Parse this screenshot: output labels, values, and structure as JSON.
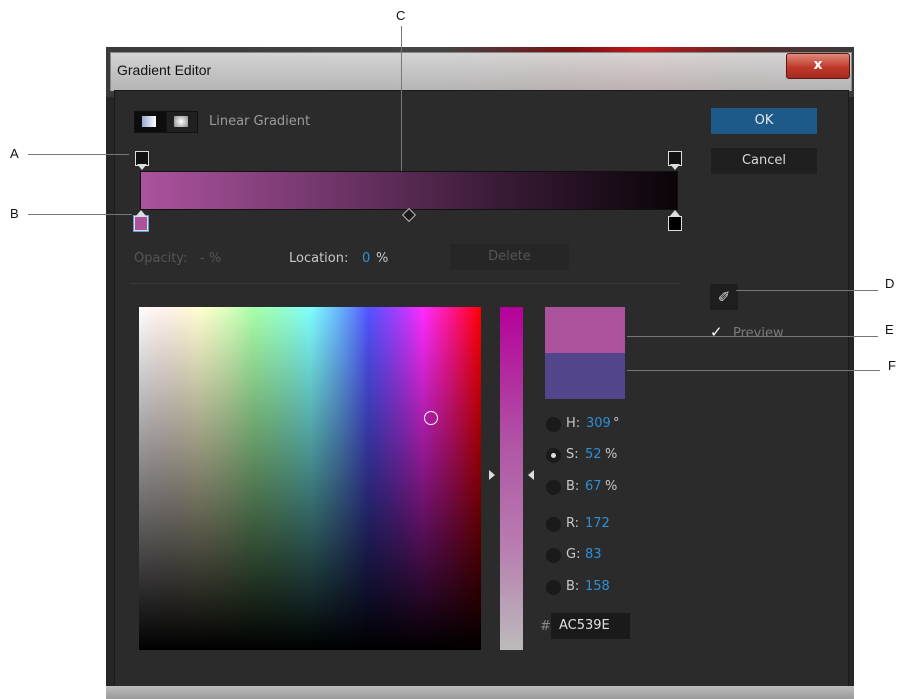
{
  "window": {
    "title": "Gradient Editor",
    "close_glyph": "x"
  },
  "gradient_type": {
    "label": "Linear Gradient",
    "options": [
      "linear-gradient-icon",
      "radial-gradient-icon"
    ]
  },
  "buttons": {
    "ok": "OK",
    "cancel": "Cancel",
    "delete": "Delete"
  },
  "stop_settings": {
    "opacity_label": "Opacity:",
    "opacity_value": "- %",
    "location_label": "Location:",
    "location_value": "0",
    "location_unit": "%"
  },
  "gradient": {
    "start_color": "#AC539E",
    "end_color": "#000000"
  },
  "swatches": {
    "new_color": "#AC539E",
    "old_color": "#54448C"
  },
  "preview": {
    "label": "Preview",
    "checked": true,
    "check_glyph": "✓"
  },
  "eyedropper": {
    "icon": "eyedropper-icon",
    "glyph": "✐"
  },
  "color_values": {
    "h": {
      "label": "H:",
      "value": "309",
      "unit": "°"
    },
    "s": {
      "label": "S:",
      "value": "52",
      "unit": "%"
    },
    "b": {
      "label": "B:",
      "value": "67",
      "unit": "%"
    },
    "r": {
      "label": "R:",
      "value": "172"
    },
    "g": {
      "label": "G:",
      "value": "83"
    },
    "b2": {
      "label": "B:",
      "value": "158"
    },
    "hex_prefix": "#",
    "hex": "AC539E"
  },
  "callouts": {
    "a": "A",
    "b": "B",
    "c": "C",
    "d": "D",
    "e": "E",
    "f": "F"
  }
}
